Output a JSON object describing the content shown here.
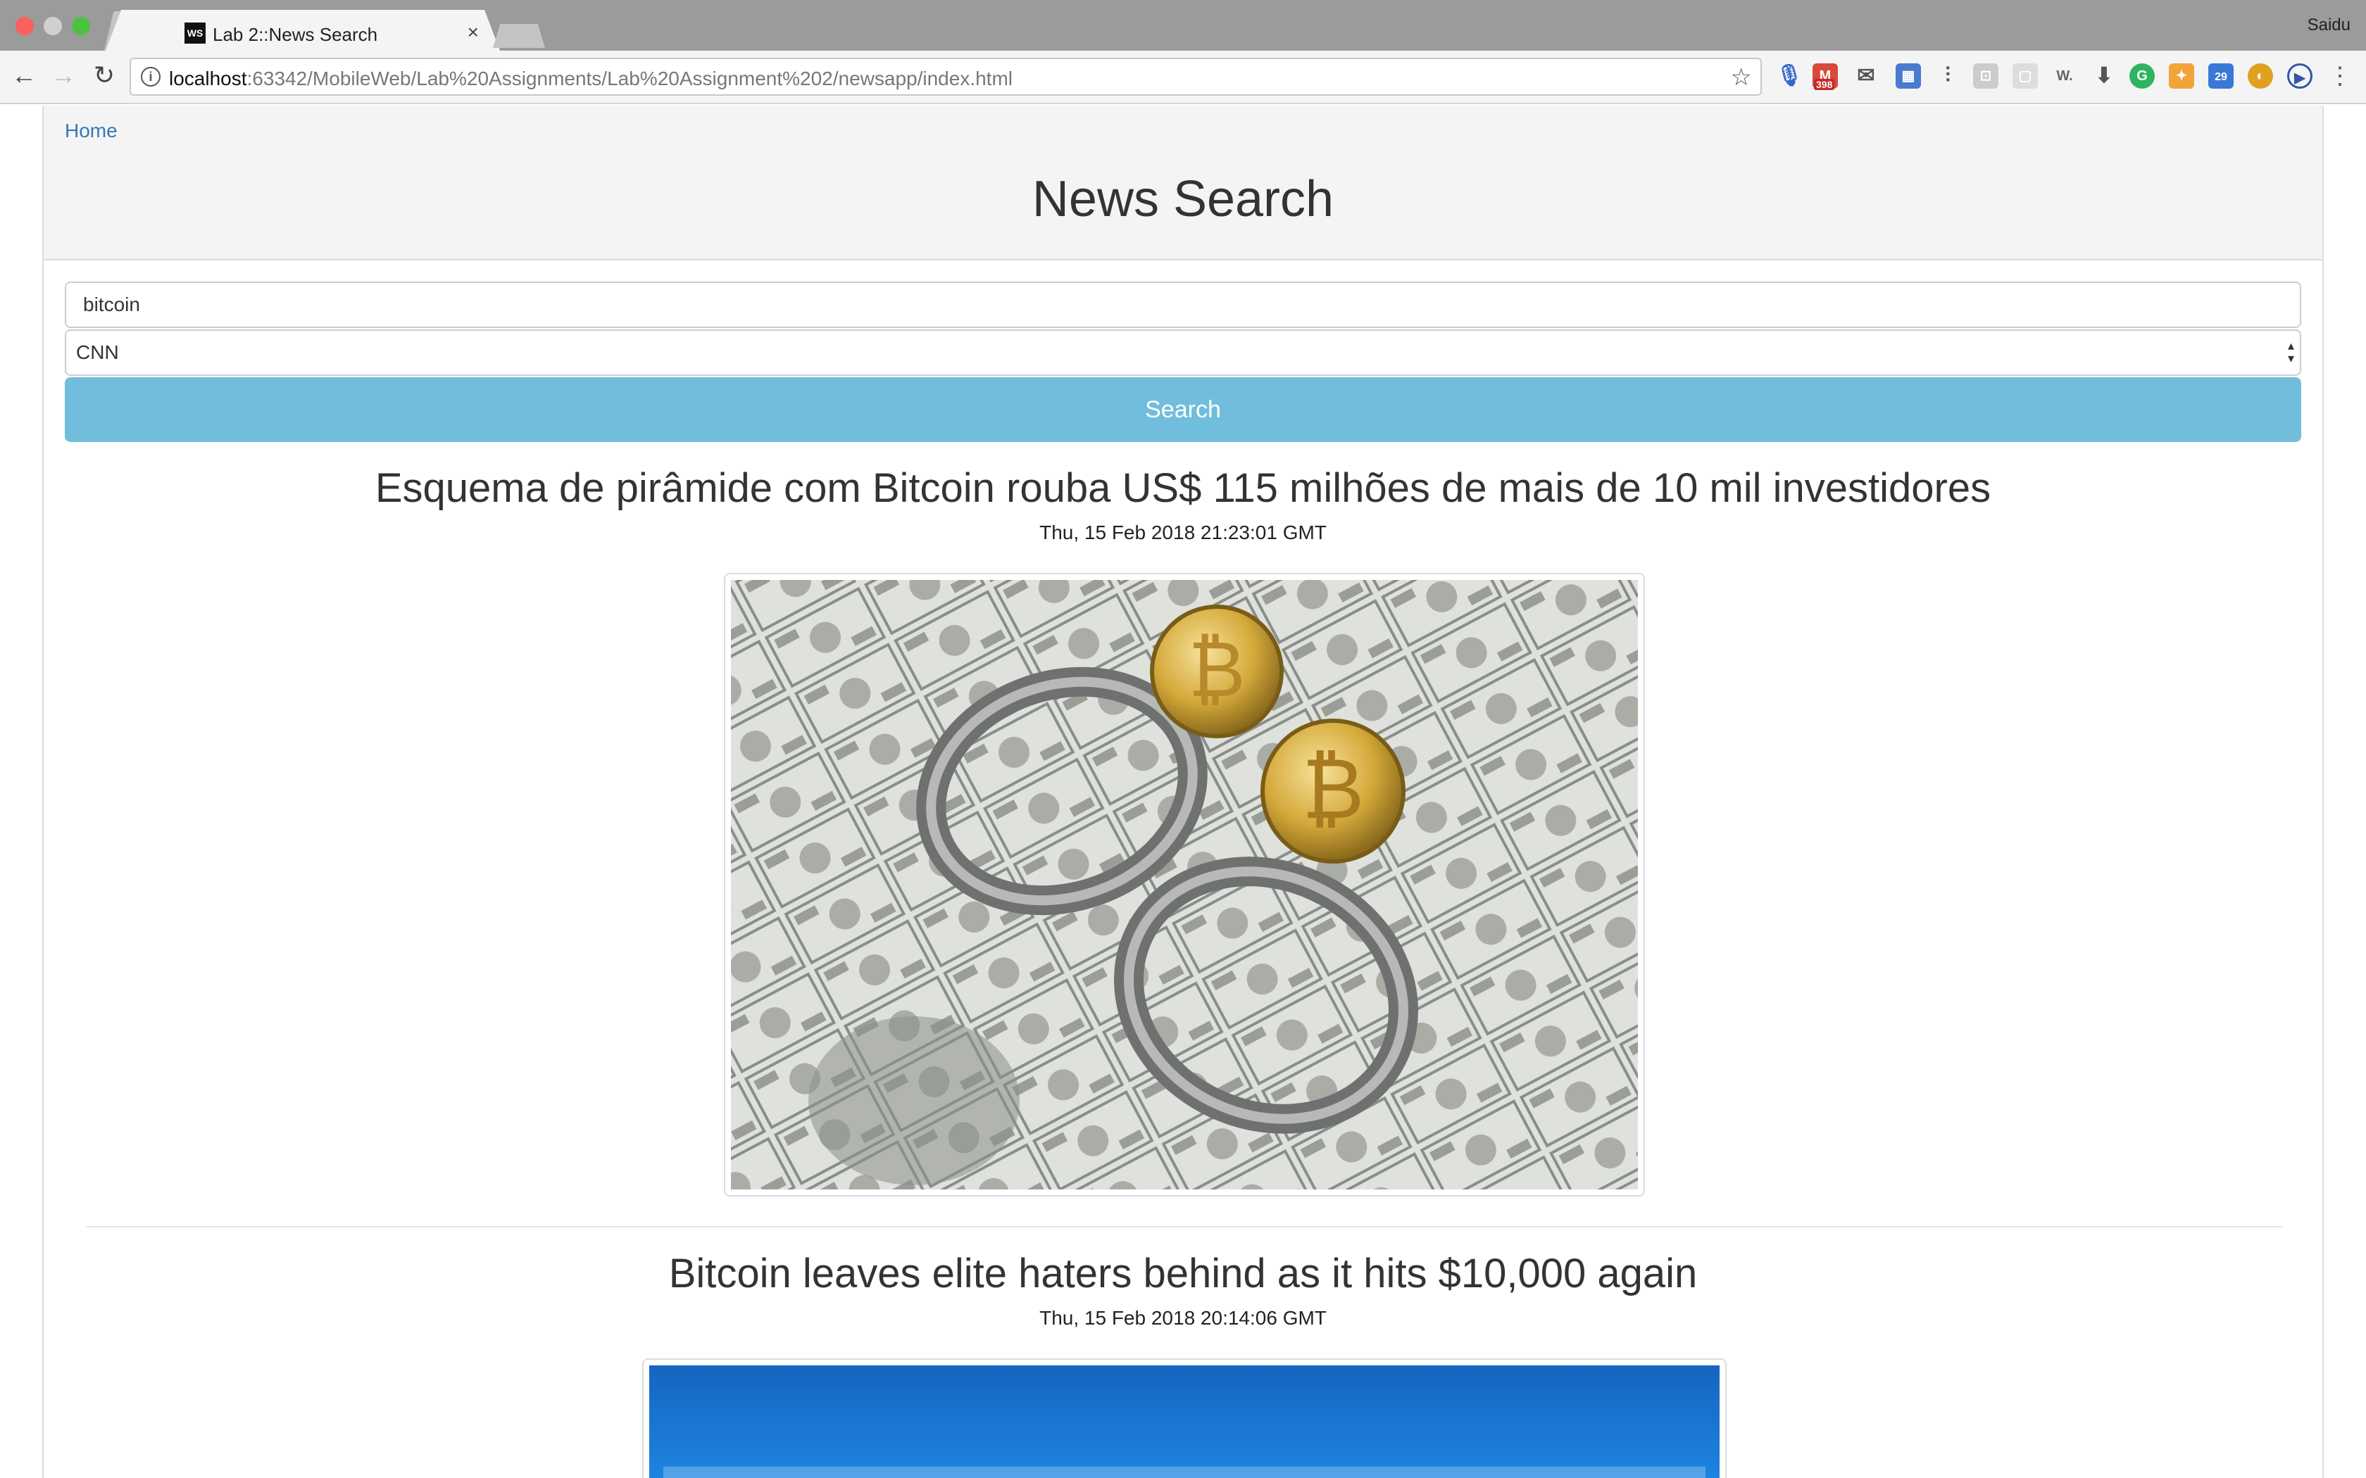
{
  "browser": {
    "tab_title": "Lab 2::News Search",
    "favicon_text": "WS",
    "profile_name": "Saidu",
    "url_host": "localhost",
    "url_rest": ":63342/MobileWeb/Lab%20Assignments/Lab%20Assignment%202/newsapp/index.html",
    "extension_badge": "398",
    "calendar_badge": "29"
  },
  "nav": {
    "home": "Home"
  },
  "header": {
    "title": "News Search"
  },
  "search": {
    "query": "bitcoin",
    "source_options": [
      "CNN"
    ],
    "selected_source": "CNN",
    "button_label": "Search"
  },
  "articles": [
    {
      "title": "Esquema de pirâmide com Bitcoin rouba US$ 115 milhões de mais de 10 mil investidores",
      "date": "Thu, 15 Feb 2018 21:23:01 GMT",
      "image": "bitcoins-handcuffs-dollar-bills"
    },
    {
      "title": "Bitcoin leaves elite haters behind as it hits $10,000 again",
      "date": "Thu, 15 Feb 2018 20:14:06 GMT",
      "image": "blue-digital-currency-banner"
    }
  ]
}
